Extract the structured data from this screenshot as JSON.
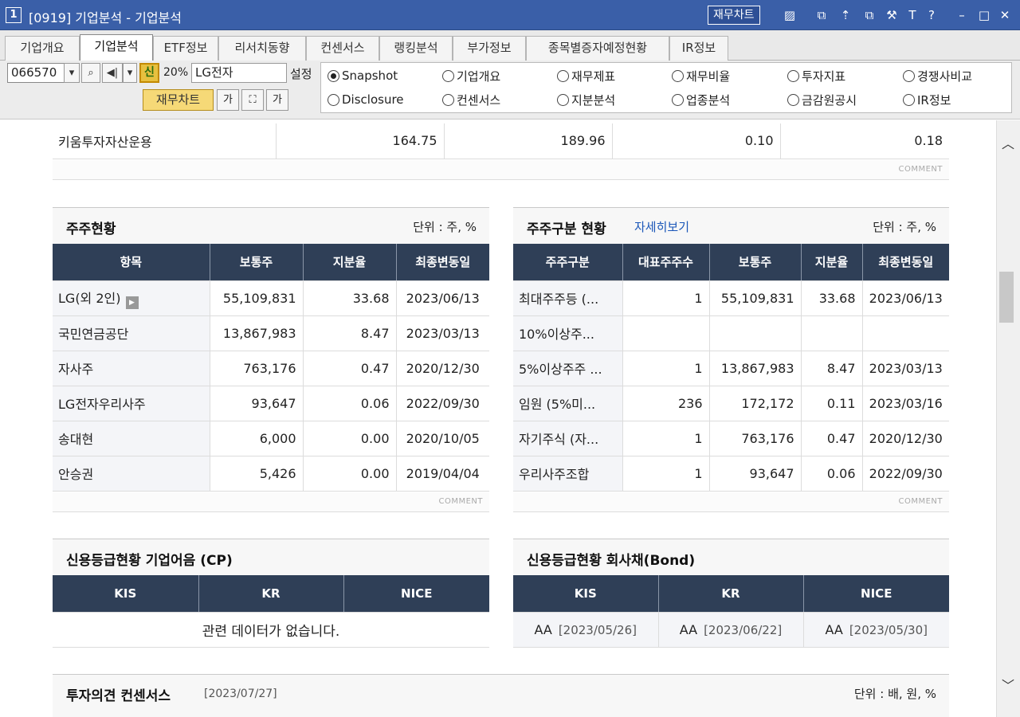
{
  "window": {
    "number": "1",
    "title": "[0919] 기업분석 - 기업분석",
    "fin_chart_button": "재무차트",
    "icons": [
      "chart-icon",
      "window-icon",
      "pin-icon",
      "copy-icon",
      "tool-icon",
      "font-icon",
      "help-icon",
      "minimize-icon",
      "maximize-icon",
      "close-icon"
    ],
    "icon_glyphs": {
      "chart": "▨",
      "window": "⧉",
      "pin": "⇡",
      "copy": "⧉",
      "tool": "⚒",
      "font": "T",
      "help": "?",
      "minimize": "–",
      "maximize": "□",
      "close": "✕"
    }
  },
  "tabs": [
    "기업개요",
    "기업분석",
    "ETF정보",
    "리서치동향",
    "컨센서스",
    "랭킹분석",
    "부가정보",
    "종목별증자예정현황",
    "IR정보"
  ],
  "active_tab": 1,
  "toolbar": {
    "code": "066570",
    "shin_label": "신",
    "pct": "20%",
    "stock_name": "LG전자",
    "setting_label": "설정",
    "fin_chart_label": "재무차트",
    "font_small": "가",
    "font_large": "가"
  },
  "radios": [
    {
      "label": "Snapshot",
      "selected": true
    },
    {
      "label": "기업개요",
      "selected": false
    },
    {
      "label": "재무제표",
      "selected": false
    },
    {
      "label": "재무비율",
      "selected": false
    },
    {
      "label": "투자지표",
      "selected": false
    },
    {
      "label": "경쟁사비교",
      "selected": false
    },
    {
      "label": "Disclosure",
      "selected": false
    },
    {
      "label": "컨센서스",
      "selected": false
    },
    {
      "label": "지분분석",
      "selected": false
    },
    {
      "label": "업종분석",
      "selected": false
    },
    {
      "label": "금감원공시",
      "selected": false
    },
    {
      "label": "IR정보",
      "selected": false
    }
  ],
  "top_row": {
    "name": "키움투자자산운용",
    "values": [
      "164.75",
      "189.96",
      "0.10",
      "0.18"
    ]
  },
  "comment_label": "COMMENT",
  "shareholders": {
    "title": "주주현황",
    "unit": "단위 : 주, %",
    "headers": [
      "항목",
      "보통주",
      "지분율",
      "최종변동일"
    ],
    "rows": [
      [
        "LG(외 2인)",
        "55,109,831",
        "33.68",
        "2023/06/13"
      ],
      [
        "국민연금공단",
        "13,867,983",
        "8.47",
        "2023/03/13"
      ],
      [
        "자사주",
        "763,176",
        "0.47",
        "2020/12/30"
      ],
      [
        "LG전자우리사주",
        "93,647",
        "0.06",
        "2022/09/30"
      ],
      [
        "송대현",
        "6,000",
        "0.00",
        "2020/10/05"
      ],
      [
        "안승권",
        "5,426",
        "0.00",
        "2019/04/04"
      ]
    ]
  },
  "shareholder_types": {
    "title": "주주구분 현황",
    "link": "자세히보기",
    "unit": "단위 : 주, %",
    "headers": [
      "주주구분",
      "대표주주수",
      "보통주",
      "지분율",
      "최종변동일"
    ],
    "rows": [
      [
        "최대주주등 (...",
        "1",
        "55,109,831",
        "33.68",
        "2023/06/13"
      ],
      [
        "10%이상주...",
        "",
        "",
        "",
        ""
      ],
      [
        "5%이상주주 ...",
        "1",
        "13,867,983",
        "8.47",
        "2023/03/13"
      ],
      [
        "임원 (5%미...",
        "236",
        "172,172",
        "0.11",
        "2023/03/16"
      ],
      [
        "자기주식 (자...",
        "1",
        "763,176",
        "0.47",
        "2020/12/30"
      ],
      [
        "우리사주조합",
        "1",
        "93,647",
        "0.06",
        "2022/09/30"
      ]
    ]
  },
  "credit_cp": {
    "title": "신용등급현황 기업어음 (CP)",
    "headers": [
      "KIS",
      "KR",
      "NICE"
    ],
    "empty": "관련 데이터가 없습니다."
  },
  "credit_bond": {
    "title": "신용등급현황 회사채(Bond)",
    "headers": [
      "KIS",
      "KR",
      "NICE"
    ],
    "grades": [
      {
        "grade": "AA",
        "date": "[2023/05/26]"
      },
      {
        "grade": "AA",
        "date": "[2023/06/22]"
      },
      {
        "grade": "AA",
        "date": "[2023/05/30]"
      }
    ]
  },
  "consensus": {
    "title": "투자의견 컨센서스",
    "date": "[2023/07/27]",
    "unit": "단위 : 배, 원, %"
  },
  "scroll": {
    "up": "︿",
    "down": "﹀"
  }
}
